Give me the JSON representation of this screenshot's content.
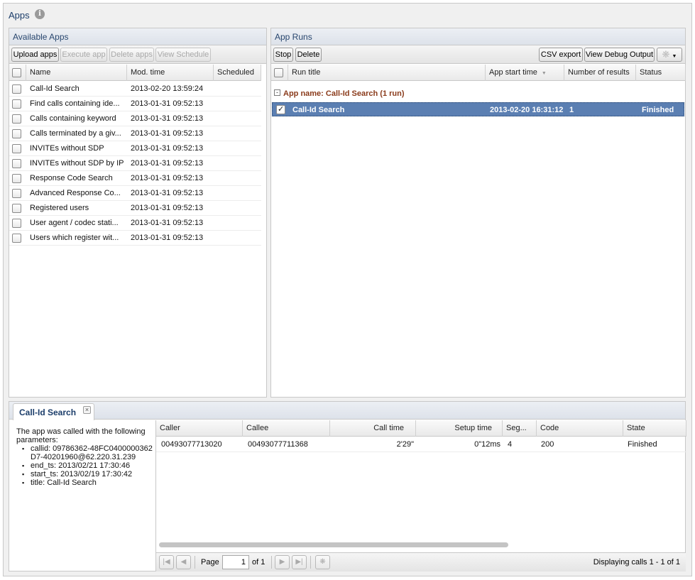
{
  "app": {
    "title": "Apps",
    "info_icon": "info-icon"
  },
  "available_apps": {
    "title": "Available Apps",
    "toolbar": {
      "upload": "Upload apps",
      "execute": "Execute app",
      "delete": "Delete apps",
      "schedule": "View Schedule"
    },
    "columns": {
      "name": "Name",
      "mod_time": "Mod. time",
      "scheduled": "Scheduled"
    },
    "rows": [
      {
        "name": "Call-Id Search",
        "mod_time": "2013-02-20 13:59:24"
      },
      {
        "name": "Find calls containing ide...",
        "mod_time": "2013-01-31 09:52:13"
      },
      {
        "name": "Calls containing keyword",
        "mod_time": "2013-01-31 09:52:13"
      },
      {
        "name": "Calls terminated by a giv...",
        "mod_time": "2013-01-31 09:52:13"
      },
      {
        "name": "INVITEs without SDP",
        "mod_time": "2013-01-31 09:52:13"
      },
      {
        "name": "INVITEs without SDP by IP",
        "mod_time": "2013-01-31 09:52:13"
      },
      {
        "name": "Response Code Search",
        "mod_time": "2013-01-31 09:52:13"
      },
      {
        "name": "Advanced Response Co...",
        "mod_time": "2013-01-31 09:52:13"
      },
      {
        "name": "Registered users",
        "mod_time": "2013-01-31 09:52:13"
      },
      {
        "name": "User agent / codec stati...",
        "mod_time": "2013-01-31 09:52:13"
      },
      {
        "name": "Users which register wit...",
        "mod_time": "2013-01-31 09:52:13"
      }
    ]
  },
  "app_runs": {
    "title": "App Runs",
    "toolbar": {
      "stop": "Stop",
      "delete": "Delete",
      "csv": "CSV export",
      "debug": "View Debug Output"
    },
    "columns": {
      "run_title": "Run title",
      "start_time": "App start time",
      "results": "Number of results",
      "status": "Status"
    },
    "group_label": "App name: Call-Id Search (1 run)",
    "selected_run": {
      "title": "Call-Id Search",
      "start_time": "2013-02-20 16:31:12",
      "results": "1",
      "status": "Finished"
    }
  },
  "detail": {
    "tab_label": "Call-Id Search",
    "intro": "The app was called with the following parameters:",
    "params": [
      "callid: 09786362-48FC0400000362D7-40201960@62.220.31.239",
      "end_ts: 2013/02/21 17:30:46",
      "start_ts: 2013/02/19 17:30:42",
      "title: Call-Id Search"
    ],
    "columns": {
      "caller": "Caller",
      "callee": "Callee",
      "call_time": "Call time",
      "setup_time": "Setup time",
      "seg": "Seg...",
      "code": "Code",
      "state": "State"
    },
    "rows": [
      {
        "caller": "00493077713020",
        "callee": "00493077711368",
        "call_time": "2'29\"",
        "setup_time": "0\"12ms",
        "seg": "4",
        "code": "200",
        "state": "Finished"
      }
    ],
    "pager": {
      "page_label": "Page",
      "page_value": "1",
      "of_label": "of 1",
      "display": "Displaying calls 1 - 1 of 1"
    }
  }
}
